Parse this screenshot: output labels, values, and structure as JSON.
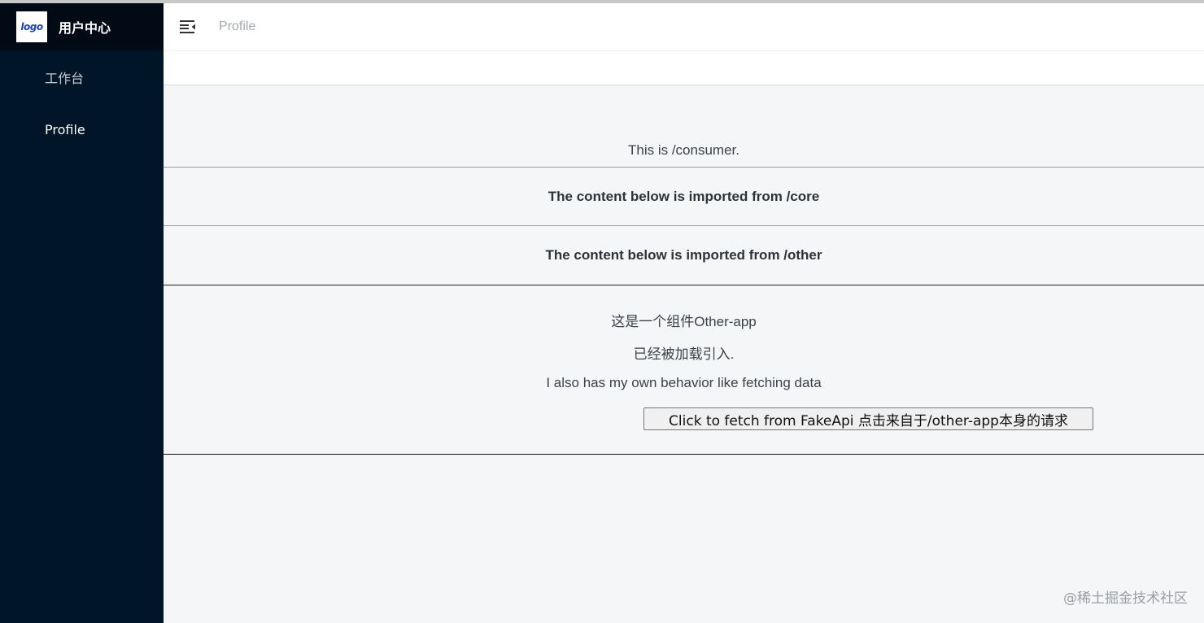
{
  "sidebar": {
    "logo_text": "logo",
    "title": "用户中心",
    "items": [
      {
        "label": "工作台"
      },
      {
        "label": "Profile"
      }
    ]
  },
  "header": {
    "breadcrumb": "Profile"
  },
  "content": {
    "consumer_text": "This is /consumer.",
    "core_heading": "The content below is imported from /core",
    "other_heading": "The content below is imported from /other",
    "other_app": {
      "line1": "这是一个组件Other-app",
      "line2": "已经被加载引入.",
      "line3": "I also has my own behavior like fetching data",
      "button_label": "Click to fetch from FakeApi 点击来自于/other-app本身的请求"
    }
  },
  "watermark": "@稀土掘金技术社区",
  "colors": {
    "sidebar_bg": "#011528",
    "brand_bg": "#020b15",
    "content_bg": "#f5f6f8"
  }
}
